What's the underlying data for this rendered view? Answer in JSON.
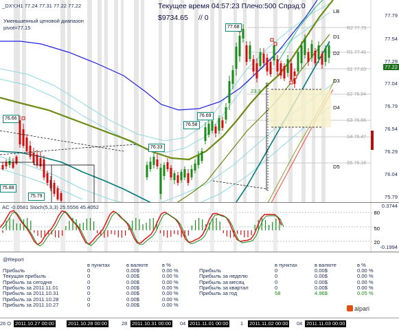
{
  "header": {
    "symbol_line": "_DXY,H1  77.24 77.31 77.22 77.22",
    "server_info": "Текущее время 04:57:23 Плечо:500 Спрэд:0",
    "balance": "$9734.65",
    "slash": "// 0",
    "note1": "Уменьшенный ценовой диапазон",
    "note2": "pivot=77.15"
  },
  "price_axis": {
    "ticks": [
      "77.79",
      "77.54",
      "77.29",
      "77.04",
      "76.79",
      "76.54",
      "76.29",
      "76.04",
      "75.79"
    ],
    "current": "77.22"
  },
  "levels": [
    {
      "name": "LB",
      "value": ""
    },
    {
      "name": "D1",
      "value": ""
    },
    {
      "name": "D2",
      "value": ""
    },
    {
      "name": "D3",
      "value": ""
    },
    {
      "name": "D4",
      "value": ""
    },
    {
      "name": "D5",
      "value": ""
    },
    {
      "name": "R2",
      "value": "77.70"
    },
    {
      "name": "R1",
      "value": "77.41"
    },
    {
      "name": "S1",
      "value": "77.03"
    },
    {
      "name": "S2",
      "value": "76.94"
    },
    {
      "name": "S3",
      "value": "76.66"
    },
    {
      "name": "S4",
      "value": "76.47"
    },
    {
      "name": "S5",
      "value": "76.18"
    }
  ],
  "price_tags": [
    "76.66",
    "75.88",
    "75.79",
    "76.33",
    "76.58",
    "76.69",
    "77.68"
  ],
  "chart_misc": {
    "bar_count": "23.3"
  },
  "oscillator": {
    "title": "AC -0.0581  Stoch(5,3,3) 25.5556 45.4052",
    "ticks": [
      "0.3744",
      "80",
      "50",
      "20",
      "-0.1994"
    ]
  },
  "report": {
    "title": "@Report",
    "col_points": "в пунктах",
    "col_currency": "в валюте",
    "col_percent": "в %",
    "left_rows": [
      {
        "label": "Прибыль",
        "points": "0",
        "currency": "0.00$",
        "percent": "0.00 %"
      },
      {
        "label": "Текущая прибыль",
        "points": "0",
        "currency": "0.00$",
        "percent": "0.00 %"
      },
      {
        "label": "Прибыль за сегодня",
        "points": "0",
        "currency": "0.00$",
        "percent": "0.00 %"
      },
      {
        "label": "Прибыль за 2011.11.01",
        "points": "0",
        "currency": "0.00$",
        "percent": "0.00 %"
      },
      {
        "label": "Прибыль за 2011.10.31",
        "points": "0",
        "currency": "0.00$",
        "percent": "0.00 %"
      },
      {
        "label": "Прибыль за 2011.10.28",
        "points": "0",
        "currency": "0.00$",
        "percent": "0.00 %"
      },
      {
        "label": "Прибыль за 2011.10.27",
        "points": "0",
        "currency": "0.00$",
        "percent": "0.00 %"
      }
    ],
    "right_rows": [
      {
        "label": "Прибыль",
        "points": "0",
        "currency": "0.00$",
        "percent": "0.00 %"
      },
      {
        "label": "Прибыль за неделю",
        "points": "0",
        "currency": "0.00$",
        "percent": "0.00 %"
      },
      {
        "label": "Прибыль за месяц",
        "points": "0",
        "currency": "0.00$",
        "percent": "0.00 %"
      },
      {
        "label": "Прибыль за квартал",
        "points": "0",
        "currency": "0.00$",
        "percent": "0.00 %"
      },
      {
        "label": "Прибыль за год",
        "points": "58",
        "currency": "4.96$",
        "percent": "0.05 %"
      }
    ],
    "brand": "alpari"
  },
  "time_axis": [
    {
      "label": "26 O",
      "dark": false
    },
    {
      "label": "2011.10.27 00:00",
      "dark": true
    },
    {
      "label": "2011.10.28 00:00",
      "dark": true
    },
    {
      "label": "28",
      "dark": false
    },
    {
      "label": "2011.10.31 00:00",
      "dark": true
    },
    {
      "label": "04",
      "dark": false
    },
    {
      "label": "2011.11.01 00:00",
      "dark": true
    },
    {
      "label": "1",
      "dark": false
    },
    {
      "label": "2011.11.02 00:00",
      "dark": true
    },
    {
      "label": "04",
      "dark": false
    },
    {
      "label": "2011.11.03 00:00",
      "dark": true
    }
  ],
  "colors": {
    "up": "#1a8a1a",
    "down": "#d01010",
    "ma_blue": "#2020e0",
    "ma_olive": "#6a8a10",
    "teal": "#007a7a",
    "light_cyan": "#8fd8e0"
  }
}
